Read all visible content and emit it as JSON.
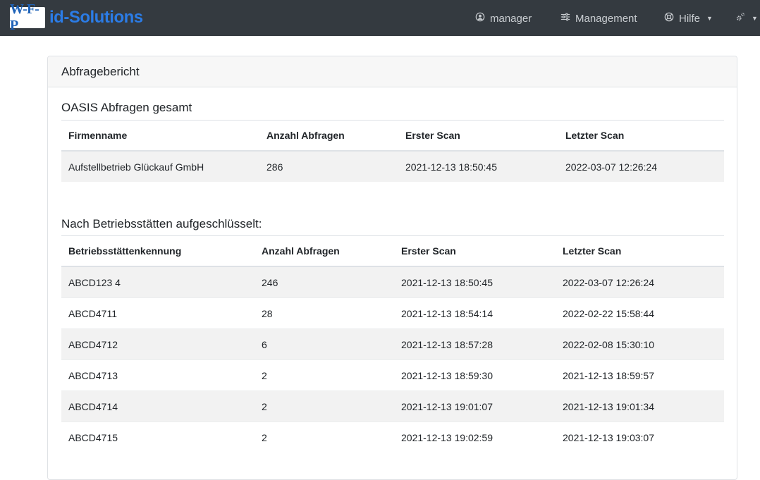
{
  "navbar": {
    "logo_text": "W-F-P",
    "brand_text": "id-Solutions",
    "user_label": "manager",
    "management_label": "Management",
    "help_label": "Hilfe",
    "colors": {
      "background": "#343a40",
      "brand": "#2b7ce6",
      "link": "#c9cdd1"
    },
    "icons": [
      "user-circle-icon",
      "sliders-icon",
      "lifebuoy-icon",
      "cogs-icon"
    ]
  },
  "report": {
    "title": "Abfragebericht",
    "total": {
      "heading": "OASIS Abfragen gesamt",
      "columns": [
        "Firmenname",
        "Anzahl Abfragen",
        "Erster Scan",
        "Letzter Scan"
      ],
      "rows": [
        [
          "Aufstellbetrieb Glückauf GmbH",
          "286",
          "2021-12-13 18:50:45",
          "2022-03-07 12:26:24"
        ]
      ]
    },
    "by_site": {
      "heading": "Nach Betriebsstätten aufgeschlüsselt:",
      "columns": [
        "Betriebsstättenkennung",
        "Anzahl Abfragen",
        "Erster Scan",
        "Letzter Scan"
      ],
      "rows": [
        [
          "ABCD123 4",
          "246",
          "2021-12-13 18:50:45",
          "2022-03-07 12:26:24"
        ],
        [
          "ABCD4711",
          "28",
          "2021-12-13 18:54:14",
          "2022-02-22 15:58:44"
        ],
        [
          "ABCD4712",
          "6",
          "2021-12-13 18:57:28",
          "2022-02-08 15:30:10"
        ],
        [
          "ABCD4713",
          "2",
          "2021-12-13 18:59:30",
          "2021-12-13 18:59:57"
        ],
        [
          "ABCD4714",
          "2",
          "2021-12-13 19:01:07",
          "2021-12-13 19:01:34"
        ],
        [
          "ABCD4715",
          "2",
          "2021-12-13 19:02:59",
          "2021-12-13 19:03:07"
        ]
      ]
    }
  }
}
